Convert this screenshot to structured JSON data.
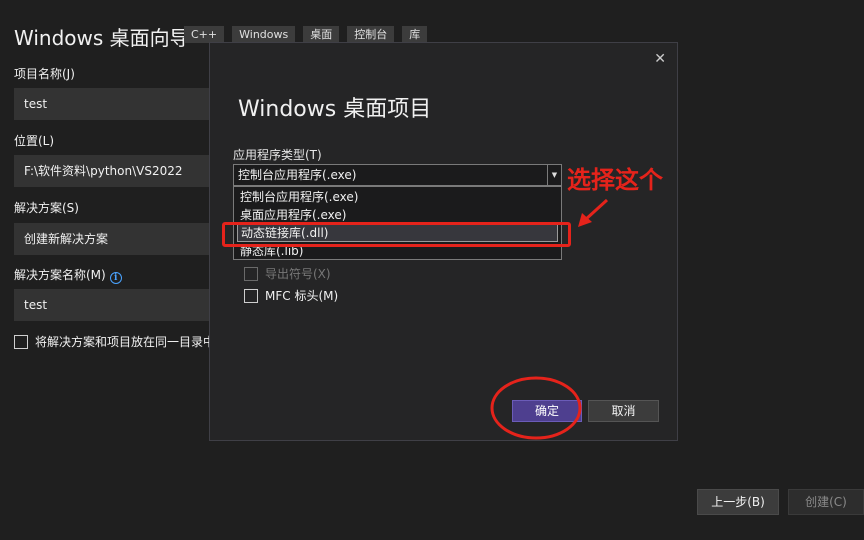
{
  "wizard": {
    "title": "Windows 桌面向导",
    "tags": [
      "C++",
      "Windows",
      "桌面",
      "控制台",
      "库"
    ]
  },
  "form": {
    "project_name_label": "项目名称(J)",
    "project_name_value": "test",
    "location_label": "位置(L)",
    "location_value": "F:\\软件资料\\python\\VS2022",
    "solution_label": "解决方案(S)",
    "solution_value": "创建新解决方案",
    "solution_name_label": "解决方案名称(M)",
    "solution_name_value": "test",
    "same_dir_label": "将解决方案和项目放在同一目录中(I"
  },
  "footer": {
    "back_label": "上一步(B)",
    "create_label": "创建(C)"
  },
  "dialog": {
    "close_glyph": "✕",
    "title": "Windows 桌面项目",
    "app_type_label": "应用程序类型(T)",
    "app_type_value": "控制台应用程序(.exe)",
    "options": [
      "控制台应用程序(.exe)",
      "桌面应用程序(.exe)",
      "动态链接库(.dll)",
      "静态库(.lib)"
    ],
    "selected_index": 2,
    "export_symbols_label": "导出符号(X)",
    "mfc_headers_label": "MFC 标头(M)",
    "ok_label": "确定",
    "cancel_label": "取消"
  },
  "annotation": {
    "text": "选择这个",
    "color": "#e5231b"
  },
  "colors": {
    "accent_button": "#4e3f8f",
    "background": "#1f1f1f",
    "dialog_background": "#252526"
  }
}
